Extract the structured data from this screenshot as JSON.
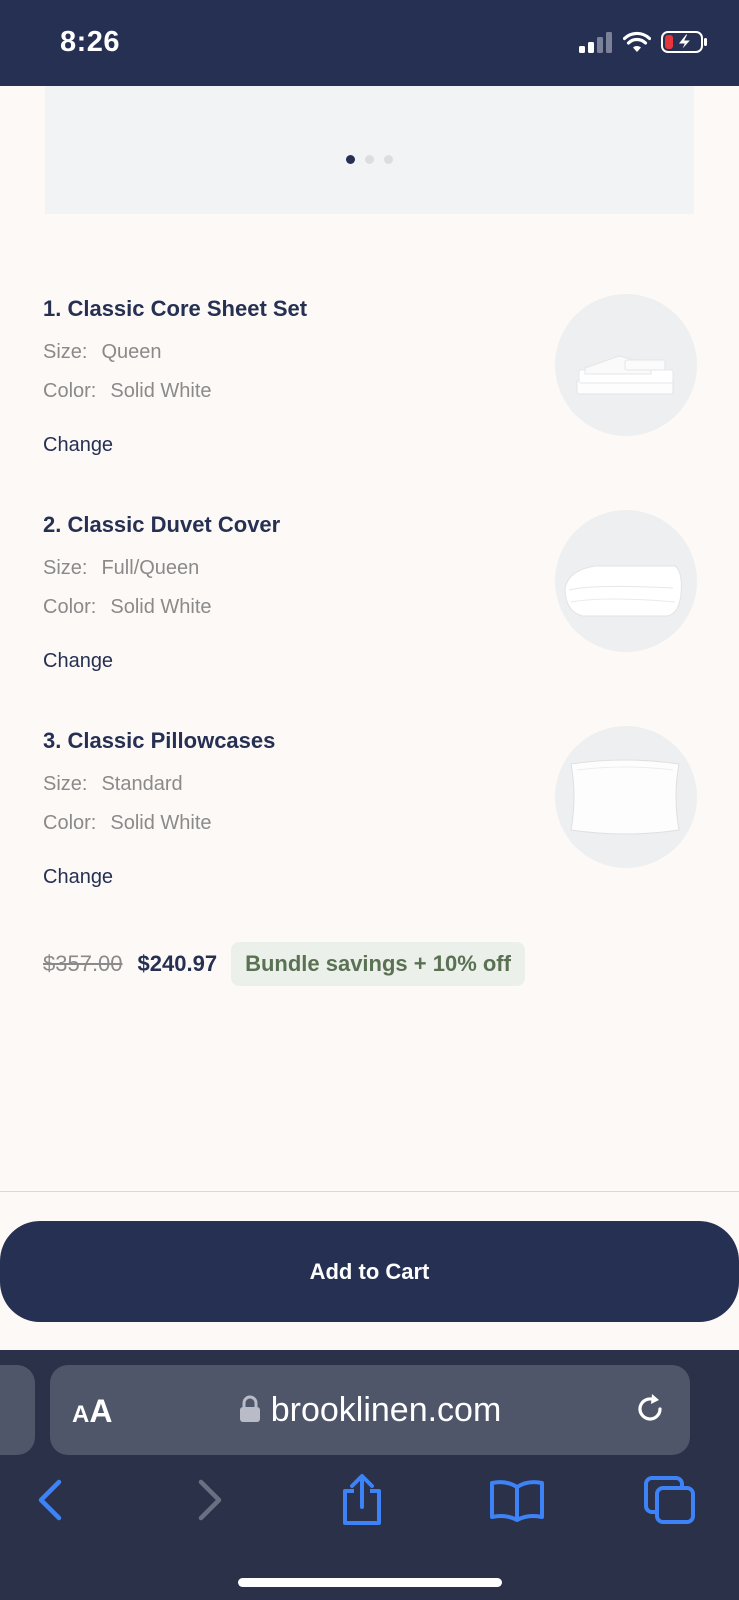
{
  "status_bar": {
    "time": "8:26"
  },
  "carousel": {
    "dots": 3,
    "active_dot": 0
  },
  "items": [
    {
      "title": "1. Classic Core Sheet Set",
      "size_label": "Size:",
      "size_value": "Queen",
      "color_label": "Color:",
      "color_value": "Solid White",
      "change_label": "Change",
      "image_icon": "sheet-set-image"
    },
    {
      "title": "2. Classic Duvet Cover",
      "size_label": "Size:",
      "size_value": "Full/Queen",
      "color_label": "Color:",
      "color_value": "Solid White",
      "change_label": "Change",
      "image_icon": "duvet-cover-image"
    },
    {
      "title": "3. Classic Pillowcases",
      "size_label": "Size:",
      "size_value": "Standard",
      "color_label": "Color:",
      "color_value": "Solid White",
      "change_label": "Change",
      "image_icon": "pillowcase-image"
    }
  ],
  "pricing": {
    "original_price": "$357.00",
    "bundle_price": "$240.97",
    "savings_badge": "Bundle savings + 10% off"
  },
  "cart": {
    "add_to_cart_label": "Add to Cart"
  },
  "browser": {
    "text_size_small": "A",
    "text_size_big": "A",
    "domain": "brooklinen.com",
    "toolbar_icons": [
      "back-icon",
      "forward-icon",
      "share-icon",
      "bookmarks-icon",
      "tabs-icon"
    ]
  },
  "colors": {
    "navy": "#253053",
    "background": "#fdf9f6",
    "savings_green": "#5b7153",
    "browser_accent": "#3d82f6"
  }
}
